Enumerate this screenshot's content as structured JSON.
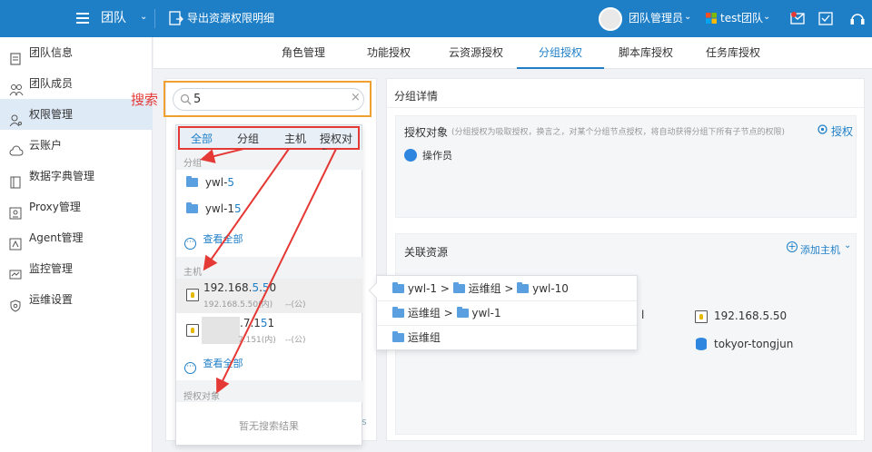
{
  "topbar": {
    "team_label": "团队",
    "export_label": "导出资源权限明细",
    "admin_label": "团队管理员",
    "team_name": "test团队"
  },
  "sidebar": {
    "items": [
      {
        "label": "团队信息"
      },
      {
        "label": "团队成员"
      },
      {
        "label": "权限管理"
      },
      {
        "label": "云账户"
      },
      {
        "label": "数据字典管理"
      },
      {
        "label": "Proxy管理"
      },
      {
        "label": "Agent管理"
      },
      {
        "label": "监控管理"
      },
      {
        "label": "运维设置"
      }
    ]
  },
  "tabs": [
    {
      "label": "角色管理"
    },
    {
      "label": "功能授权"
    },
    {
      "label": "云资源授权"
    },
    {
      "label": "分组授权"
    },
    {
      "label": "脚本库授权"
    },
    {
      "label": "任务库授权"
    }
  ],
  "annotation": {
    "search_label": "搜索"
  },
  "search": {
    "value": "5"
  },
  "filter_tabs": [
    {
      "label": "全部"
    },
    {
      "label": "分组"
    },
    {
      "label": "主机"
    },
    {
      "label": "授权对象"
    }
  ],
  "results": {
    "group_section": "分组",
    "groups": [
      {
        "prefix": "ywl-",
        "match": "5"
      },
      {
        "prefix": "ywl-1",
        "match": "5"
      }
    ],
    "view_all_groups": "查看全部",
    "host_section": "主机",
    "hosts": [
      {
        "ip_a": "192.168.",
        "ip_m": "5",
        "ip_b": ".",
        "ip_m2": "5",
        "ip_c": "0",
        "sub": "192.168.5.50(内)",
        "sub2": "--(公)"
      },
      {
        "ip_tail_a": ".7.1",
        "ip_tail_m": "5",
        "ip_tail_b": "1",
        "sub": "7.151(内)",
        "sub2": "--(公)"
      }
    ],
    "view_all_hosts": "查看全部",
    "object_section": "授权对象",
    "no_result": "暂无搜索结果"
  },
  "group_detail": {
    "title": "分组详情",
    "auth_label": "授权对象",
    "auth_note": "(分组授权为吸取授权，换言之，对某个分组节点授权，将自动获得分组下所有子节点的权限)",
    "auth_button": "授权",
    "operator": "操作员",
    "resources_label": "关联资源",
    "add_host": "添加主机",
    "host_ip": "192.168.5.50",
    "host_fragment": "l",
    "db_name": "tokyor-tongjun"
  },
  "path_popup": {
    "rows": [
      [
        "ywl-1",
        "运维组",
        "ywl-10"
      ],
      [
        "运维组",
        "ywl-1"
      ],
      [
        "运维组"
      ]
    ]
  },
  "colors": {
    "primary": "#1e7fc7",
    "annotation": "#e53935",
    "highlight_border": "#f0a030"
  }
}
